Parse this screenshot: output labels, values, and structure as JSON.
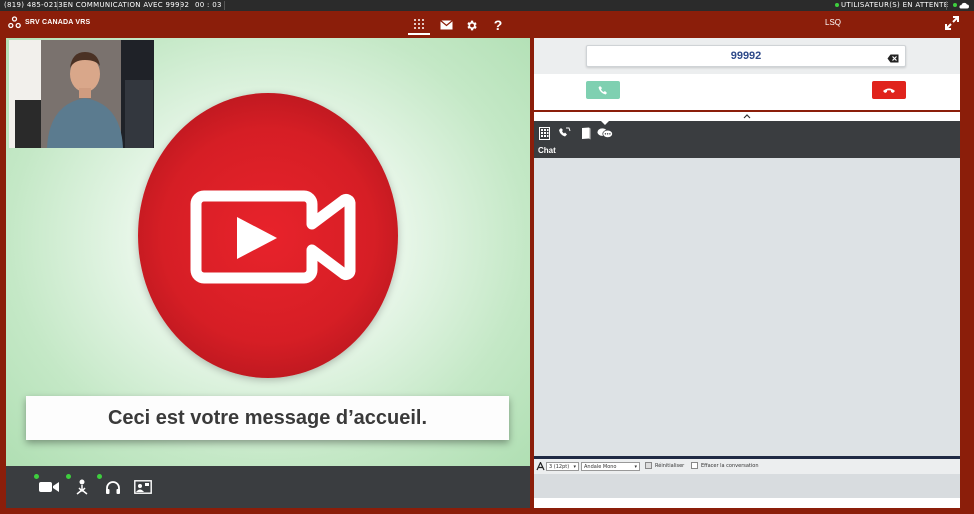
{
  "status": {
    "phone": "(819) 485-0213",
    "call_status": "EN COMMUNICATION AVEC 99992",
    "timer": "00 : 03",
    "waiting_users": "UTILISATEUR(S) EN ATTENTE",
    "indicator_color": "#3ecf3e"
  },
  "header": {
    "brand": "SRV CANADA VRS",
    "language": "LSQ",
    "nav_icons": [
      "dialpad-icon",
      "mail-icon",
      "gear-icon",
      "help-icon"
    ],
    "help_label": "?"
  },
  "video": {
    "welcome_message": "Ceci est votre message d’accueil.",
    "circle_color": "#d61e25",
    "toolbar_icons": [
      "video-camera-icon",
      "microphone-icon",
      "headset-icon",
      "self-view-icon"
    ]
  },
  "dial": {
    "number": "99992",
    "call_color": "#7fd0b1",
    "hangup_color": "#e0231c"
  },
  "chat": {
    "tab_icons": [
      "keypad-icon",
      "phone-hand-icon",
      "book-icon",
      "chat-icon"
    ],
    "label": "Chat",
    "font_size_value": "3 (12pt)",
    "font_family_value": "Andale Mono",
    "reset_label": "Réinitialiser",
    "clear_label": "Effacer la conversation"
  }
}
